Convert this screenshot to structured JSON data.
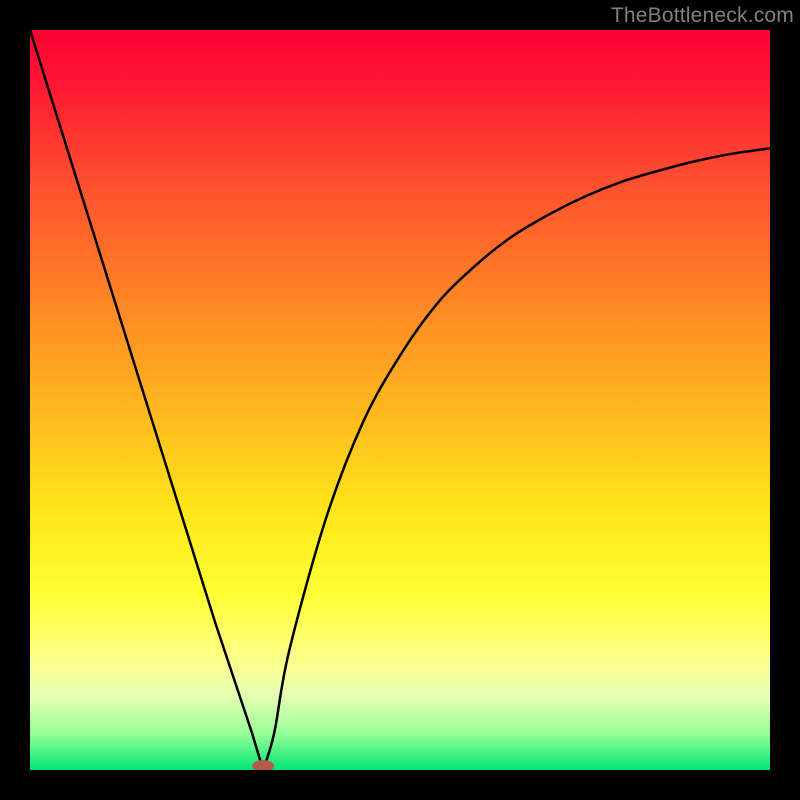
{
  "watermark": "TheBottleneck.com",
  "chart_data": {
    "type": "line",
    "title": "",
    "xlabel": "",
    "ylabel": "",
    "xlim": [
      0,
      100
    ],
    "ylim": [
      0,
      100
    ],
    "series": [
      {
        "name": "bottleneck-curve",
        "x": [
          0,
          5,
          10,
          15,
          20,
          25,
          30,
          31.5,
          33,
          35,
          40,
          45,
          50,
          55,
          60,
          65,
          70,
          75,
          80,
          85,
          90,
          95,
          100
        ],
        "y": [
          100,
          84,
          68,
          52,
          36,
          20,
          5,
          0,
          5,
          16,
          34,
          47,
          56,
          63,
          68,
          72,
          75,
          77.5,
          79.5,
          81,
          82.3,
          83.3,
          84
        ]
      }
    ],
    "marker": {
      "x": 31.5,
      "y": 0,
      "label": "optimal-point"
    },
    "background": "rainbow-gradient-red-to-green"
  }
}
